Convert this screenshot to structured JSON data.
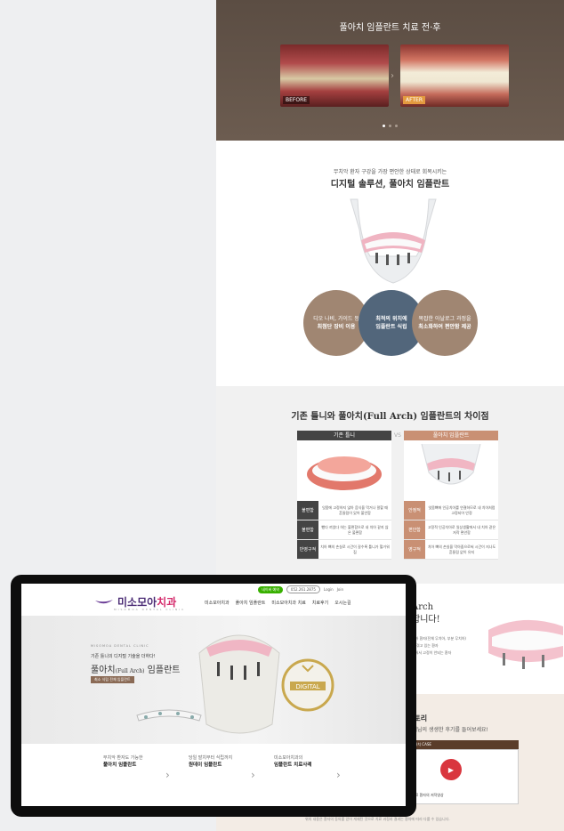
{
  "section1": {
    "title": "풀아치 임플란트 치료 전·후",
    "before_label": "BEFORE",
    "after_label": "AFTER"
  },
  "section2": {
    "subtitle": "무치악 환자 구강을 가장 편안한 상태로 회복시키는",
    "headline": "디지털 솔루션, 풀아치 임플란트",
    "circles": [
      {
        "line1": "디오 나비, 가이드 등",
        "line2": "최첨단 장비 이용"
      },
      {
        "line1": "최적의 위치에",
        "line2": "임플란트 식립"
      },
      {
        "line1": "복잡한 아날로그 과정을",
        "line2": "최소화하여 편안함 제공"
      }
    ]
  },
  "section3": {
    "headline": "기존 틀니와 풀아치(Full Arch) 임플란트의 차이점",
    "left_header": "기존 틀니",
    "vs": "VS",
    "right_header": "풀아치 임플란트",
    "left_rows": [
      {
        "key": "불편함",
        "text": "잇몸에 고정하지 않아 음식을 먹거나 말할 때 흔들림이 있어 불안함"
      },
      {
        "key": "불편함",
        "text": "뺐다 끼었다 하는 불편함으로 내 치아 같지 않은 불편함"
      },
      {
        "key": "반영구적",
        "text": "치아 뼈의 손실로 시간이 갈수록 틀니가 헐거워짐"
      }
    ],
    "right_rows": [
      {
        "key": "안정적",
        "text": "잇몸뼈에 인공치아를 연결하므로 내 치아처럼 고정되어 안정"
      },
      {
        "key": "편안함",
        "text": "고정적 인공치아로 일상생활에서 내 치아 같은 저작 편안함"
      },
      {
        "key": "영구적",
        "text": "치아 뼈의 손실을 막아줌으로써 시간이 지나도 흔들림 없이 유지"
      }
    ]
  },
  "section4": {
    "title_line1": "Arch",
    "title_line2": "합니다!",
    "lines": [
      "치아 환자(전체 무치아, 부분 무치아)",
      "을 겪고 있는 환자",
      "거워서 고정이 안되는 환자"
    ]
  },
  "section5": {
    "title": "스토리",
    "subtitle": "고객님의 생생한 후기를 들어보세요!",
    "case_label": "풀아치 CASE",
    "video_caption": "치료 환자의 저작영상",
    "footnote": "위의 내용은 환자의 동의를 얻어 게재된 것으로 치료 과정과 결과는 환자에 따라 다를 수 있습니다."
  },
  "laptop": {
    "topbar": {
      "naver": "네이버 예약",
      "phone": "052.261.2875",
      "login": "Login",
      "join": "Join"
    },
    "logo_text_a": "미소모아",
    "logo_text_b": "치과",
    "logo_sub": "MISOMOA DENTAL CLINIC",
    "nav": [
      "미소모아치과",
      "풀아치 임플란트",
      "미소모아치과 치료",
      "치료후기",
      "오시는길"
    ],
    "hero": {
      "kicker": "MISOMOA DENTAL CLINIC",
      "small": "기존 틀니의 디지털 기술을 더하다!",
      "title": "풀아치",
      "title_small": "(Full Arch)",
      "title_tail": " 임플란트",
      "tag": "최소 식립 전체 임플란트",
      "badge": "DIGITAL"
    },
    "cards": [
      {
        "a": "무치악 환자도 가능한",
        "b": "풀아치 임플란트"
      },
      {
        "a": "당일 발치부터 식립까지",
        "b": "원데이 임플란트"
      },
      {
        "a": "미소모아치과의",
        "b": "임플란트 치료사례"
      }
    ]
  }
}
